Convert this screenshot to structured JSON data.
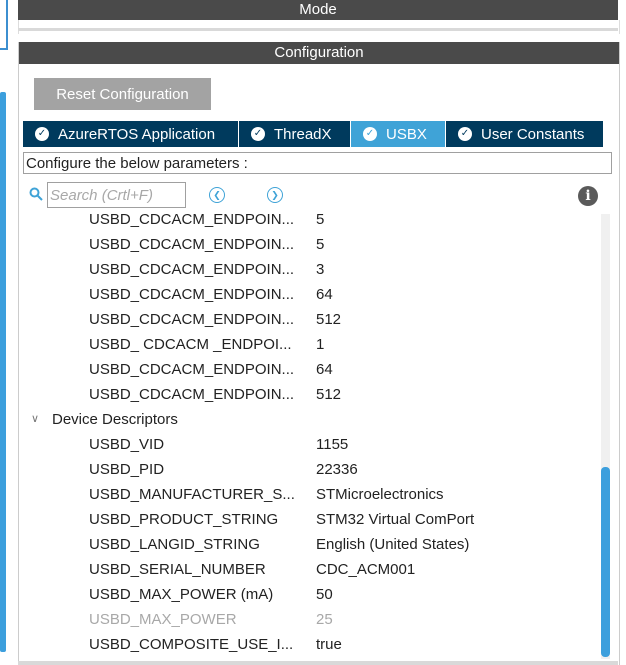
{
  "header": {
    "mode_title": "Mode",
    "config_title": "Configuration"
  },
  "reset_button": "Reset Configuration",
  "tabs": [
    {
      "label": "AzureRTOS Application",
      "active": false
    },
    {
      "label": "ThreadX",
      "active": false
    },
    {
      "label": "USBX",
      "active": true
    },
    {
      "label": "User Constants",
      "active": false
    }
  ],
  "hint": "Configure the below parameters :",
  "search": {
    "placeholder": "Search (Crtl+F)"
  },
  "params_top": [
    {
      "name": "USBD_CDCACM_ENDPOIN...",
      "value": "5"
    },
    {
      "name": "USBD_CDCACM_ENDPOIN...",
      "value": "5"
    },
    {
      "name": "USBD_CDCACM_ENDPOIN...",
      "value": "3"
    },
    {
      "name": "USBD_CDCACM_ENDPOIN...",
      "value": "64"
    },
    {
      "name": "USBD_CDCACM_ENDPOIN...",
      "value": "512"
    },
    {
      "name": "USBD_ CDCACM _ENDPOI...",
      "value": "1"
    },
    {
      "name": "USBD_CDCACM_ENDPOIN...",
      "value": "64"
    },
    {
      "name": "USBD_CDCACM_ENDPOIN...",
      "value": "512"
    }
  ],
  "group": {
    "label": "Device Descriptors"
  },
  "params_device": [
    {
      "name": "USBD_VID",
      "value": "1155"
    },
    {
      "name": "USBD_PID",
      "value": "22336"
    },
    {
      "name": "USBD_MANUFACTURER_S...",
      "value": "STMicroelectronics"
    },
    {
      "name": "USBD_PRODUCT_STRING",
      "value": "STM32 Virtual ComPort"
    },
    {
      "name": "USBD_LANGID_STRING",
      "value": "English (United States)"
    },
    {
      "name": "USBD_SERIAL_NUMBER",
      "value": "CDC_ACM001"
    },
    {
      "name": "USBD_MAX_POWER (mA)",
      "value": "50"
    },
    {
      "name": "USBD_MAX_POWER",
      "value": "25"
    },
    {
      "name": "USBD_COMPOSITE_USE_I...",
      "value": "true"
    }
  ]
}
